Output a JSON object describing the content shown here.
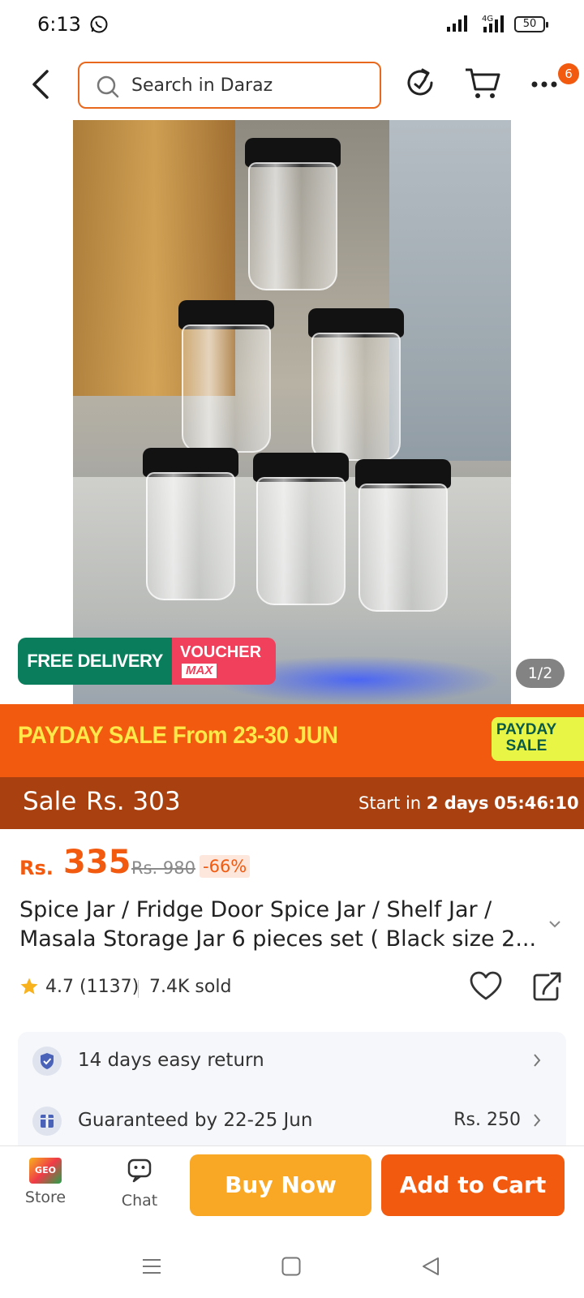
{
  "status_bar": {
    "time": "6:13",
    "network": "4G",
    "battery": "50"
  },
  "header": {
    "search_placeholder": "Search in Daraz",
    "more_badge": "6"
  },
  "gallery": {
    "free_delivery": "FREE DELIVERY",
    "voucher_line1": "VOUCHER",
    "voucher_line2": "MAX",
    "counter": "1/2"
  },
  "payday_banner": {
    "text": "PAYDAY SALE From 23-30 JUN",
    "logo_line1": "PAYDAY",
    "logo_line2": "SALE"
  },
  "sale_strip": {
    "label": "Sale",
    "price": "Rs. 303",
    "start_prefix": "Start in ",
    "start_days": "2 days",
    "timer": "05:46:10"
  },
  "price": {
    "currency": "Rs.",
    "amount": "335",
    "original": "Rs. 980",
    "discount": "-66%"
  },
  "product": {
    "title": "Spice Jar / Fridge Door Spice Jar / Shelf Jar / Masala Storage Jar 6 pieces set ( Black size 2...",
    "rating": "4.7",
    "reviews": "(1137)",
    "sold": "7.4K sold"
  },
  "info": {
    "return_label": "14 days easy return",
    "delivery_label": "Guaranteed by 22-25 Jun",
    "delivery_price": "Rs. 250"
  },
  "bottom_bar": {
    "store_label": "Store",
    "store_logo": "GEO",
    "chat_label": "Chat",
    "buy_now": "Buy Now",
    "add_to_cart": "Add to Cart"
  },
  "colors": {
    "brand_orange": "#f25a0f",
    "buy_now_yellow": "#f9a825",
    "sale_strip": "#a8400f",
    "free_delivery_green": "#0a7d5d",
    "voucher_pink": "#f0405c"
  }
}
